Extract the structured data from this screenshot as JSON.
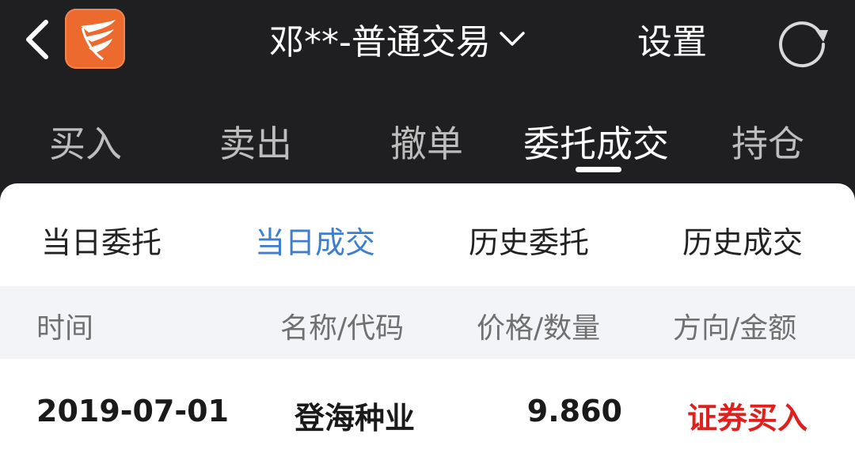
{
  "header": {
    "title": "邓**-普通交易",
    "settings_label": "设置"
  },
  "tabs": [
    {
      "label": "买入"
    },
    {
      "label": "卖出"
    },
    {
      "label": "撤单"
    },
    {
      "label": "委托成交",
      "active": true
    },
    {
      "label": "持仓"
    }
  ],
  "subtabs": [
    {
      "label": "当日委托"
    },
    {
      "label": "当日成交",
      "active": true
    },
    {
      "label": "历史委托"
    },
    {
      "label": "历史成交"
    }
  ],
  "table": {
    "columns": [
      "时间",
      "名称/代码",
      "价格/数量",
      "方向/金额"
    ],
    "rows": [
      {
        "time": "2019-07-01",
        "name": "登海种业",
        "price": "9.860",
        "direction": "证券买入"
      }
    ]
  },
  "colors": {
    "header_bg": "#1f1f21",
    "accent_blue": "#3d7ecf",
    "buy_red": "#e0201e",
    "logo_orange": "#ec6a2d"
  },
  "icons": {
    "back": "chevron-left-icon",
    "logo": "app-logo",
    "title_dropdown": "chevron-down-icon",
    "refresh": "refresh-icon"
  }
}
